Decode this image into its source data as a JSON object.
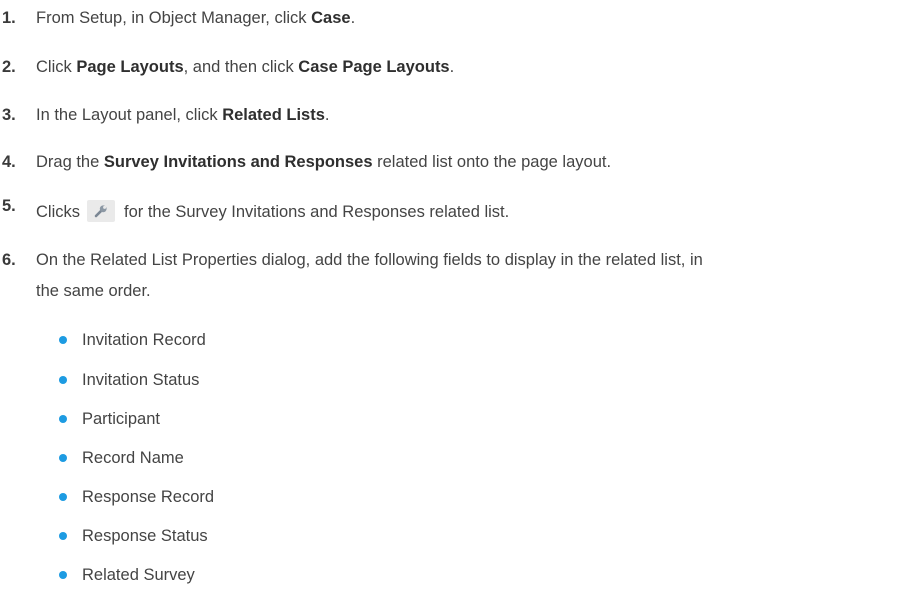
{
  "steps": [
    {
      "number": "1.",
      "parts": {
        "a": "From Setup, in Object Manager, click ",
        "b": "Case",
        "c": "."
      }
    },
    {
      "number": "2.",
      "parts": {
        "a": "Click ",
        "b": "Page Layouts",
        "c": ", and then click ",
        "d": "Case Page Layouts",
        "e": "."
      }
    },
    {
      "number": "3.",
      "parts": {
        "a": "In the Layout panel, click ",
        "b": "Related Lists",
        "c": "."
      }
    },
    {
      "number": "4.",
      "parts": {
        "a": "Drag the ",
        "b": "Survey Invitations and Responses",
        "c": " related list onto the page layout."
      }
    },
    {
      "number": "5.",
      "parts": {
        "a": "Clicks",
        "c": "for the Survey Invitations and Responses related list."
      },
      "icon": "wrench-icon"
    },
    {
      "number": "6.",
      "parts": {
        "a": "On the Related List Properties dialog, add the following fields to display in the related list, in",
        "b": "the same order."
      }
    }
  ],
  "fields": [
    "Invitation Record",
    "Invitation Status",
    "Participant",
    "Record Name",
    "Response Record",
    "Response Status",
    "Related Survey"
  ],
  "colors": {
    "text": "#444444",
    "bullet": "#1d9be2",
    "button_bg": "#eaeaea"
  }
}
